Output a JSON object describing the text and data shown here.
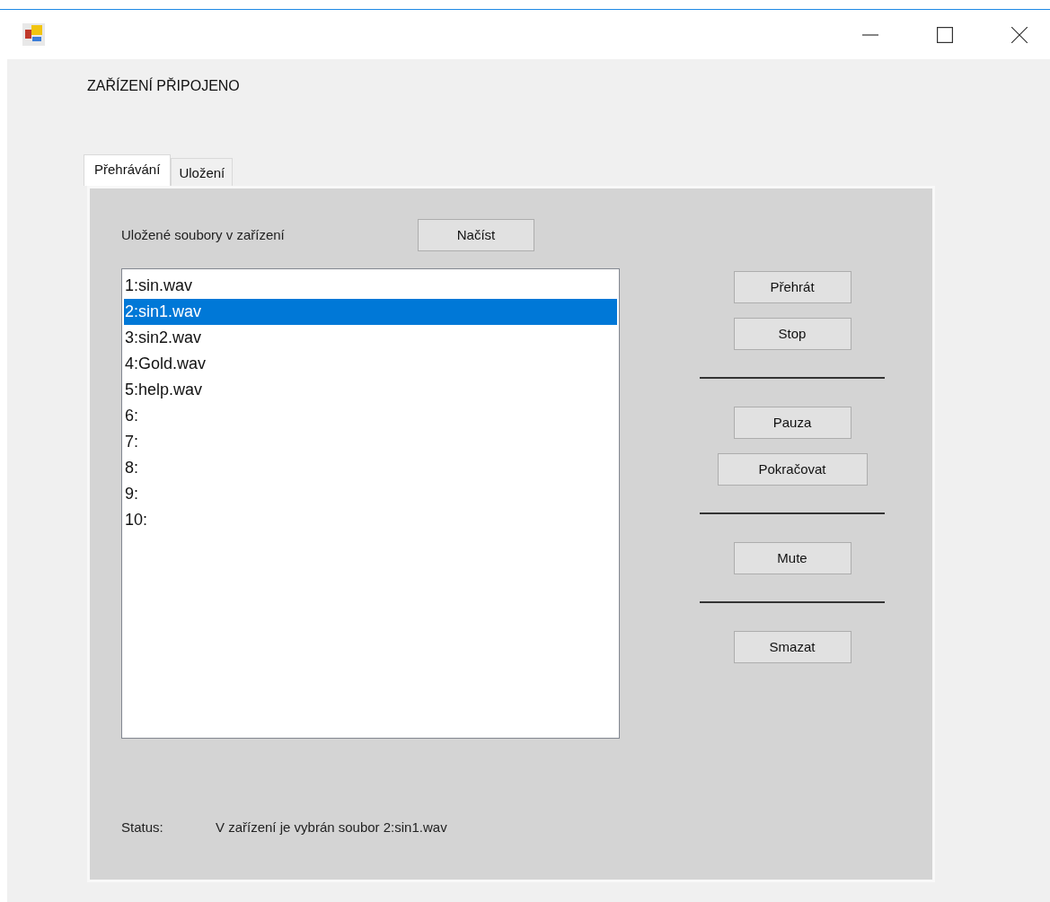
{
  "header": "ZAŘÍZENÍ PŘIPOJENO",
  "tabs": [
    {
      "label": "Přehrávání",
      "selected": true
    },
    {
      "label": "Uložení",
      "selected": false
    }
  ],
  "files_label": "Uložené soubory v zařízení",
  "load_button": "Načíst",
  "files": [
    {
      "label": "1:sin.wav",
      "selected": false
    },
    {
      "label": "2:sin1.wav",
      "selected": true
    },
    {
      "label": "3:sin2.wav",
      "selected": false
    },
    {
      "label": "4:Gold.wav",
      "selected": false
    },
    {
      "label": "5:help.wav",
      "selected": false
    },
    {
      "label": "6:",
      "selected": false
    },
    {
      "label": "7:",
      "selected": false
    },
    {
      "label": "8:",
      "selected": false
    },
    {
      "label": "9:",
      "selected": false
    },
    {
      "label": "10:",
      "selected": false
    }
  ],
  "controls": [
    {
      "kind": "button",
      "label": "Přehrát"
    },
    {
      "kind": "button",
      "label": "Stop"
    },
    {
      "kind": "rule"
    },
    {
      "kind": "button",
      "label": "Pauza"
    },
    {
      "kind": "button",
      "label": "Pokračovat",
      "wide": true
    },
    {
      "kind": "rule"
    },
    {
      "kind": "button",
      "label": "Mute"
    },
    {
      "kind": "rule"
    },
    {
      "kind": "button",
      "label": "Smazat"
    }
  ],
  "status": {
    "label": "Status:",
    "text": "V zařízení je vybrán soubor 2:sin1.wav"
  }
}
